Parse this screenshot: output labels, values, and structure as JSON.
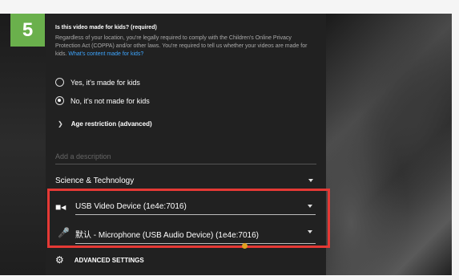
{
  "step": {
    "number": "5"
  },
  "kids": {
    "title": "Is this video made for kids? (required)",
    "body": "Regardless of your location, you're legally required to comply with the Children's Online Privacy Protection Act (COPPA) and/or other laws. You're required to tell us whether your videos are made for kids.",
    "link": "What's content made for kids?",
    "options": [
      {
        "label": "Yes, it's made for kids",
        "checked": false
      },
      {
        "label": "No, it's not made for kids",
        "checked": true
      }
    ]
  },
  "age_restriction": {
    "label": "Age restriction (advanced)"
  },
  "description": {
    "placeholder": "Add a description"
  },
  "category": {
    "value": "Science & Technology"
  },
  "devices": {
    "camera": {
      "icon": "video-camera-icon",
      "value": "USB Video Device (1e4e:7016)"
    },
    "microphone": {
      "icon": "microphone-icon",
      "value": "默认 - Microphone (USB Audio Device) (1e4e:7016)"
    }
  },
  "advanced": {
    "label": "ADVANCED SETTINGS",
    "icon": "gear-icon"
  },
  "colors": {
    "highlight": "#e53935",
    "badge": "#6ab04c",
    "link": "#3ea6ff"
  }
}
